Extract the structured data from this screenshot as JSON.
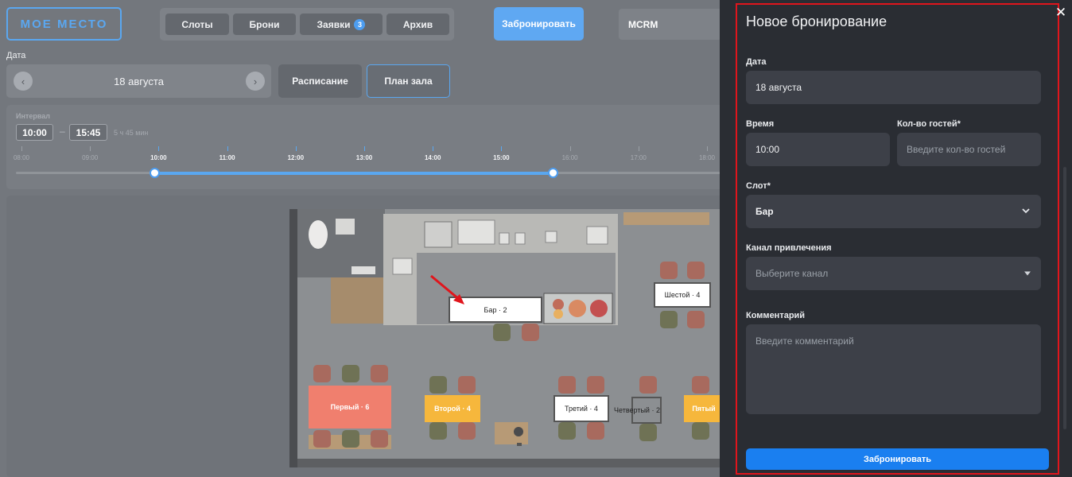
{
  "app": {
    "logo": "МОЕ МЕСТО",
    "tabs": [
      {
        "label": "Слоты"
      },
      {
        "label": "Брони"
      },
      {
        "label": "Заявки",
        "badge": "3"
      },
      {
        "label": "Архив"
      }
    ],
    "book_button": "Забронировать",
    "org_name": "MCRM",
    "date_label": "Дата",
    "date_value": "18 августа",
    "prev_icon": "‹",
    "next_icon": "›",
    "view_buttons": [
      "Расписание",
      "План зала"
    ],
    "interval": {
      "label": "Интервал",
      "from": "10:00",
      "to": "15:45",
      "separator": "–",
      "duration": "5 ч 45 мин",
      "ticks": [
        "08:00",
        "09:00",
        "10:00",
        "11:00",
        "12:00",
        "13:00",
        "14:00",
        "15:00",
        "16:00",
        "17:00",
        "18:00"
      ]
    },
    "floor_plan": {
      "tables": [
        "Бар · 2",
        "Шестой · 4",
        "Первый · 6",
        "Второй · 4",
        "Третий · 4",
        "Четвертый · 2",
        "Пятый"
      ]
    }
  },
  "modal": {
    "title": "Новое бронирование",
    "close_icon": "✕",
    "date": {
      "label": "Дата",
      "value": "18 августа"
    },
    "time": {
      "label": "Время",
      "value": "10:00"
    },
    "guests": {
      "label": "Кол-во гостей*",
      "placeholder": "Введите кол-во гостей"
    },
    "slot": {
      "label": "Слот*",
      "value": "Бар",
      "icon": "chevron-down-icon"
    },
    "channel": {
      "label": "Канал привлечения",
      "placeholder": "Выберите канал",
      "icon": "caret-down-icon"
    },
    "comment": {
      "label": "Комментарий",
      "placeholder": "Введите комментарий"
    },
    "submit": "Забронировать"
  },
  "colors": {
    "accent": "#1a7ff0",
    "highlight_outline": "#e0151c",
    "table_coral": "#f07f6e",
    "table_yellow": "#f6b73c"
  }
}
